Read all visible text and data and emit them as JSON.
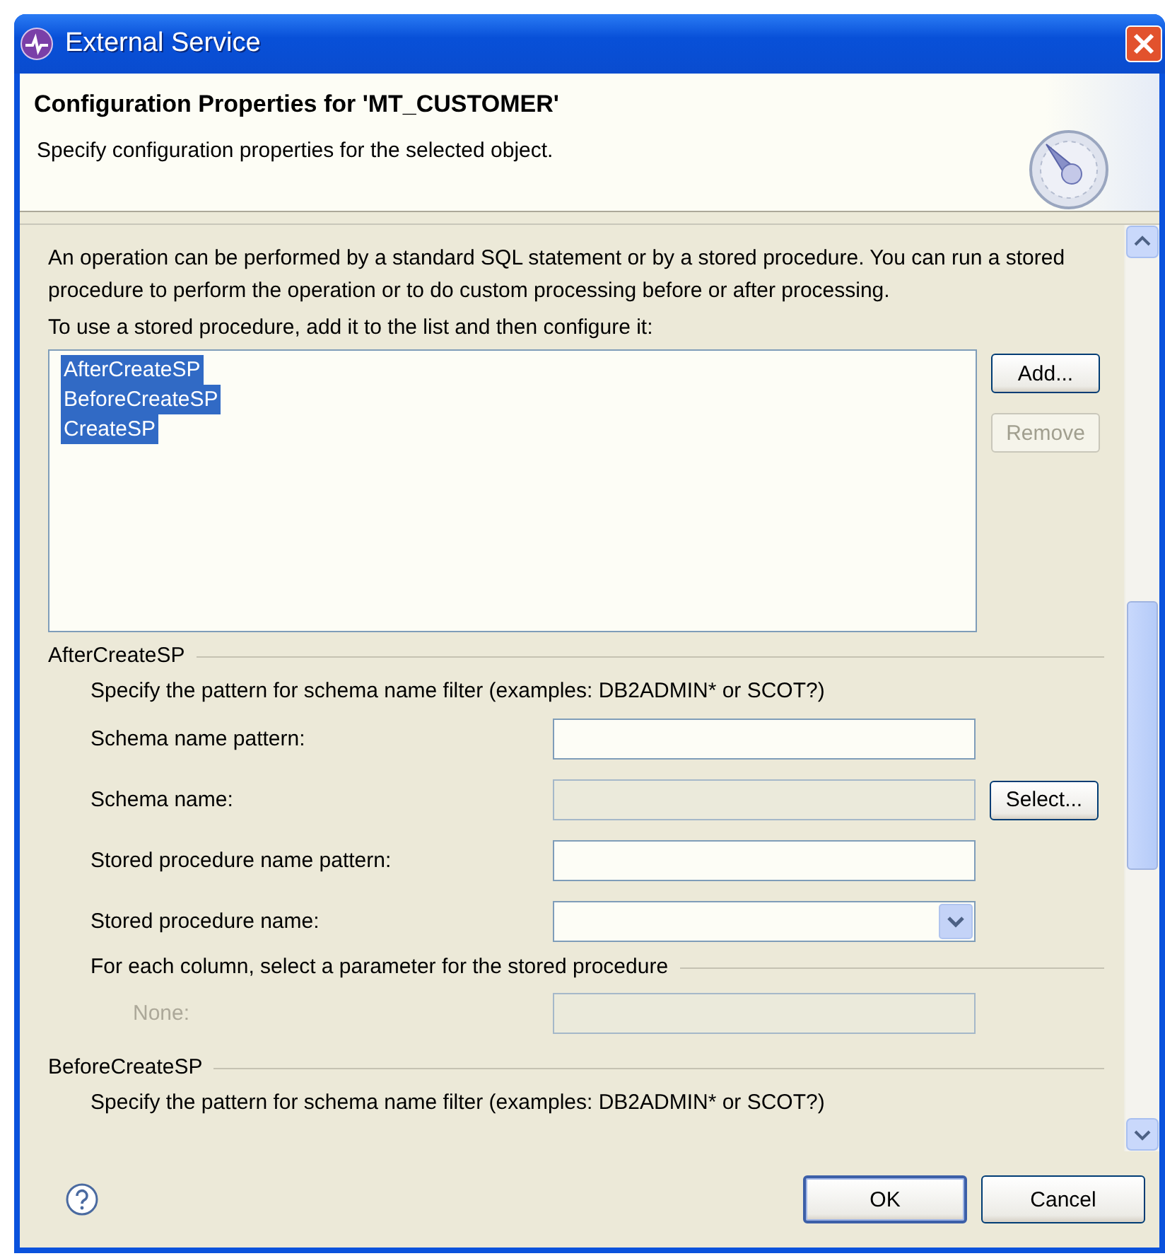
{
  "window": {
    "title": "External Service"
  },
  "header": {
    "title": "Configuration Properties for 'MT_CUSTOMER'",
    "subtitle": "Specify configuration properties for the selected object."
  },
  "intro": "An operation can be performed by a standard SQL statement or by a stored procedure. You can run a stored procedure to perform the operation or to do custom processing before or after processing.",
  "list_label": "To use a stored procedure, add it to the list and then configure it:",
  "procedures": [
    {
      "label": "AfterCreateSP",
      "selected": true
    },
    {
      "label": "BeforeCreateSP",
      "selected": true
    },
    {
      "label": "CreateSP",
      "selected": true
    }
  ],
  "list_buttons": [
    {
      "label": "Add...",
      "disabled": false
    },
    {
      "label": "Remove",
      "disabled": true
    }
  ],
  "sections": [
    {
      "title": "AfterCreateSP",
      "hint": "Specify the pattern for schema name filter (examples: DB2ADMIN* or SCOT?)",
      "fields": [
        {
          "kind": "text",
          "label": "Schema name pattern:",
          "disabled": false
        },
        {
          "kind": "text",
          "label": "Schema name:",
          "disabled": true,
          "button": "Select..."
        },
        {
          "kind": "text",
          "label": "Stored procedure name pattern:",
          "disabled": false
        },
        {
          "kind": "combo",
          "label": "Stored procedure name:",
          "disabled": false
        }
      ],
      "parameters_title": "For each column, select a parameter for the stored procedure",
      "parameters": [
        {
          "label": "None:",
          "disabled": true
        }
      ]
    },
    {
      "title": "BeforeCreateSP",
      "hint": "Specify the pattern for schema name filter (examples: DB2ADMIN* or SCOT?)"
    }
  ],
  "buttons": [
    {
      "label": "OK",
      "default": true
    },
    {
      "label": "Cancel",
      "default": false
    }
  ]
}
